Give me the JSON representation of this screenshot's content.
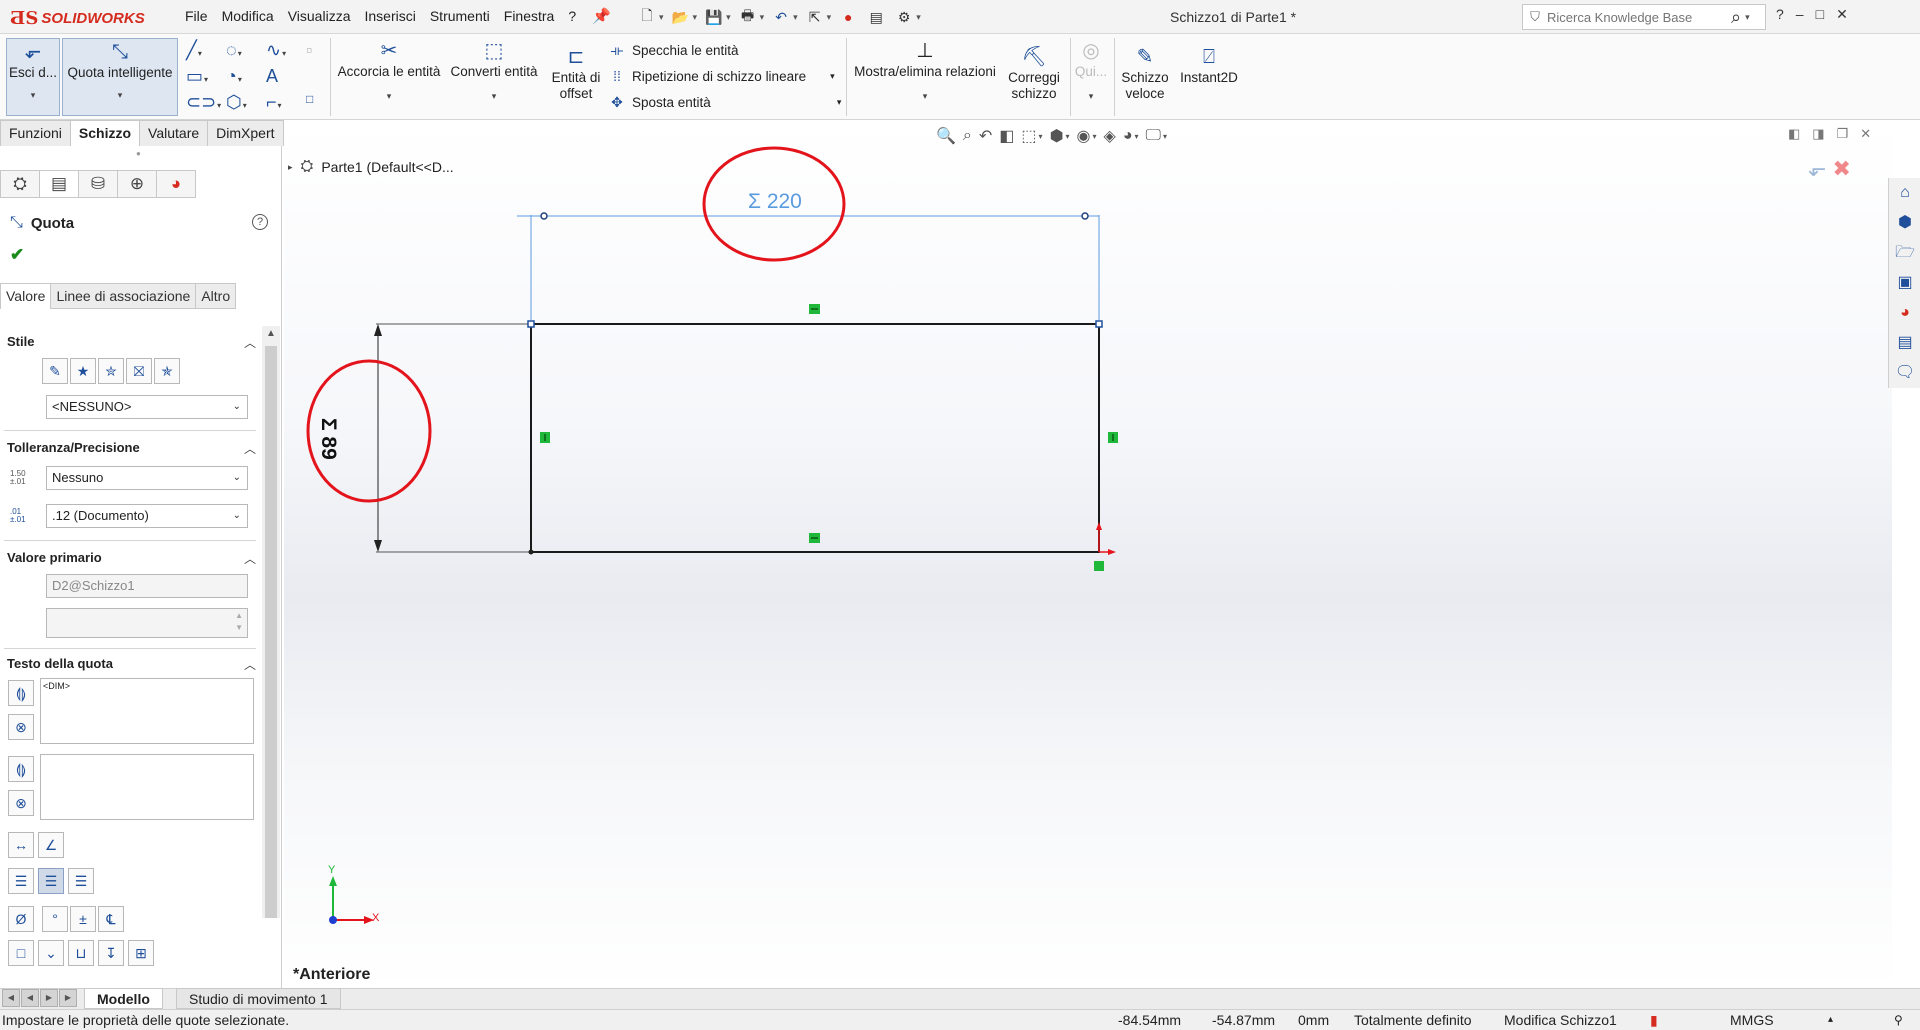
{
  "app": {
    "brand": "SOLIDWORKS",
    "document_title": "Schizzo1 di Parte1 *"
  },
  "menu": [
    "File",
    "Modifica",
    "Visualizza",
    "Inserisci",
    "Strumenti",
    "Finestra",
    "?"
  ],
  "search": {
    "placeholder": "Ricerca Knowledge Base"
  },
  "window_controls": [
    "?",
    "–",
    "□",
    "✕"
  ],
  "ribbon": {
    "exit_sketch": "Esci d...",
    "smart_dimension": "Quota intelligente",
    "trim_entities": "Accorcia le entità",
    "convert_entities": "Converti entità",
    "offset_entities_1": "Entità di",
    "offset_entities_2": "offset",
    "mirror_entities": "Specchia le entità",
    "linear_pattern": "Ripetizione di schizzo lineare",
    "move_entities": "Sposta entità",
    "display_relations": "Mostra/elimina relazioni",
    "repair_sketch_1": "Correggi",
    "repair_sketch_2": "schizzo",
    "quick_snaps": "Qui...",
    "rapid_sketch_1": "Schizzo",
    "rapid_sketch_2": "veloce",
    "instant2d": "Instant2D"
  },
  "command_tabs": [
    "Funzioni",
    "Schizzo",
    "Valutare",
    "DimXpert"
  ],
  "active_command_tab": "Schizzo",
  "property_manager": {
    "title": "Quota",
    "help": "?",
    "tabs": [
      "Valore",
      "Linee di associazione",
      "Altro"
    ],
    "sections": {
      "style": "Stile",
      "style_value": "<NESSUNO>",
      "tolerance": "Tolleranza/Precisione",
      "tolerance_value": "Nessuno",
      "precision_value": ".12 (Documento)",
      "primary_value": "Valore primario",
      "primary_name": "D2@Schizzo1",
      "primary_number": "",
      "dim_text": "Testo della quota",
      "dim_text_value": "<DIM>",
      "dim_text_value_2": ""
    },
    "tolerance_icon_label": "1.50\n±.01",
    "precision_icon_label": ".01\n±.01"
  },
  "feature_tree": {
    "part_label": "Parte1  (Default<<D..."
  },
  "sketch": {
    "horizontal_dimension": "Σ 220",
    "vertical_dimension": "Σ 89",
    "triad_y": "Y",
    "triad_x": "X"
  },
  "view_name": "*Anteriore",
  "bottom_tabs": [
    "Modello",
    "Studio di movimento 1"
  ],
  "status": {
    "message": "Impostare le proprietà delle quote selezionate.",
    "x": "-84.54mm",
    "y": "-54.87mm",
    "z": "0mm",
    "definition": "Totalmente definito",
    "editing": "Modifica Schizzo1",
    "units": "MMGS"
  },
  "colors": {
    "brand_red": "#d52b1e",
    "annotation_red": "#e3141b",
    "dimension_blue": "#5a9be0",
    "relation_green": "#1fb83a"
  }
}
